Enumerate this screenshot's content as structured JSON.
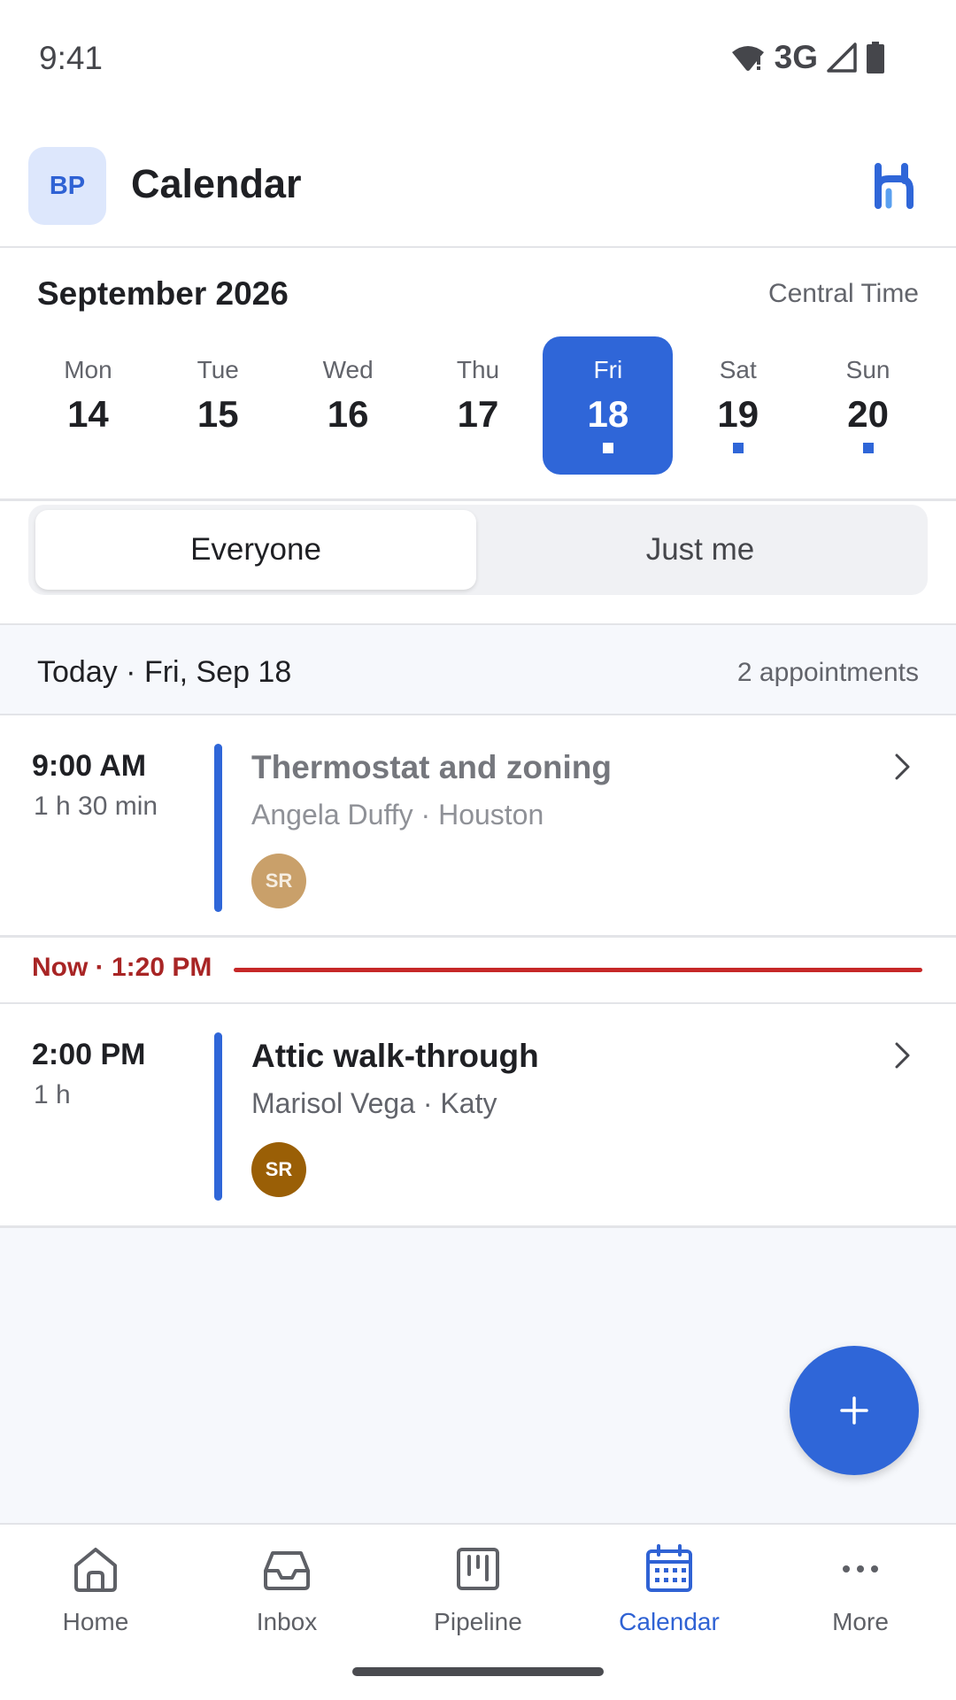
{
  "status_bar": {
    "time": "9:41",
    "network": "3G"
  },
  "app_bar": {
    "avatar_initials": "BP",
    "title": "Calendar"
  },
  "month": {
    "label": "September 2026",
    "timezone": "Central Time"
  },
  "week": [
    {
      "name": "Mon",
      "num": "14",
      "selected": false,
      "has_events": false
    },
    {
      "name": "Tue",
      "num": "15",
      "selected": false,
      "has_events": false
    },
    {
      "name": "Wed",
      "num": "16",
      "selected": false,
      "has_events": false
    },
    {
      "name": "Thu",
      "num": "17",
      "selected": false,
      "has_events": false
    },
    {
      "name": "Fri",
      "num": "18",
      "selected": true,
      "has_events": true
    },
    {
      "name": "Sat",
      "num": "19",
      "selected": false,
      "has_events": true
    },
    {
      "name": "Sun",
      "num": "20",
      "selected": false,
      "has_events": true
    }
  ],
  "filter": {
    "everyone": "Everyone",
    "just_me": "Just me",
    "selected": "everyone"
  },
  "day_header": {
    "label": "Today · Fri, Sep 18",
    "count": "2 appointments"
  },
  "appointments": [
    {
      "time": "9:00 AM",
      "duration": "1 h 30 min",
      "title": "Thermostat and zoning",
      "subtitle": "Angela Duffy · Houston",
      "assignee": "SR",
      "state": "past"
    },
    {
      "time": "2:00 PM",
      "duration": "1 h",
      "title": "Attic walk-through",
      "subtitle": "Marisol Vega · Katy",
      "assignee": "SR",
      "state": "upcoming"
    }
  ],
  "now_marker": {
    "label": "Now · 1:20 PM"
  },
  "fab": {
    "icon": "plus-icon"
  },
  "nav": [
    {
      "label": "Home",
      "icon": "home-icon",
      "active": false
    },
    {
      "label": "Inbox",
      "icon": "inbox-icon",
      "active": false
    },
    {
      "label": "Pipeline",
      "icon": "pipeline-icon",
      "active": false
    },
    {
      "label": "Calendar",
      "icon": "calendar-icon",
      "active": true
    },
    {
      "label": "More",
      "icon": "more-icon",
      "active": false
    }
  ],
  "colors": {
    "accent": "#2f66d8",
    "now_line": "#c62828",
    "text": "#1f2024",
    "muted": "#62646b"
  }
}
